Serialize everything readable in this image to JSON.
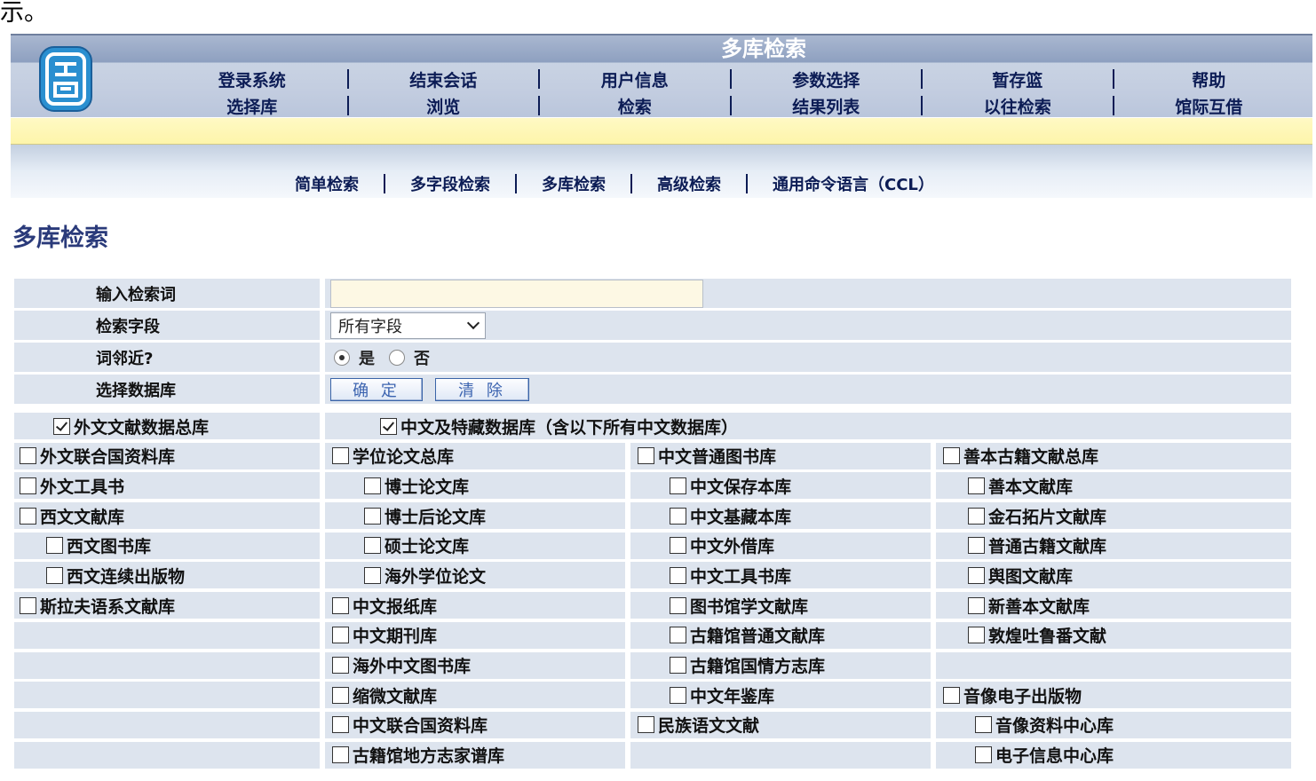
{
  "fragment_text": "示。",
  "header": {
    "title": "多库检索",
    "row1": [
      "登录系统",
      "结束会话",
      "用户信息",
      "参数选择",
      "暂存篮",
      "帮助"
    ],
    "row2": [
      "选择库",
      "浏览",
      "检索",
      "结果列表",
      "以往检索",
      "馆际互借"
    ]
  },
  "subnav": [
    "简单检索",
    "多字段检索",
    "多库检索",
    "高级检索",
    "通用命令语言（CCL）"
  ],
  "page_title": "多库检索",
  "form": {
    "keyword_label": "输入检索词",
    "keyword_value": "",
    "field_label": "检索字段",
    "field_selected": "所有字段",
    "adjacent_label": "词邻近?",
    "yes": "是",
    "no": "否",
    "yes_selected": true,
    "db_label": "选择数据库",
    "ok_button": "确 定",
    "clear_button": "清 除"
  },
  "databases": {
    "all_foreign": "外文文献数据总库",
    "all_chinese": "中文及特藏数据库（含以下所有中文数据库）",
    "col1": [
      "外文联合国资料库",
      "外文工具书",
      "西文文献库",
      "西文图书库",
      "西文连续出版物",
      "斯拉夫语系文献库"
    ],
    "col2": [
      "学位论文总库",
      "博士论文库",
      "博士后论文库",
      "硕士论文库",
      "海外学位论文",
      "中文报纸库",
      "中文期刊库",
      "海外中文图书库",
      "缩微文献库",
      "中文联合国资料库",
      "古籍馆地方志家谱库"
    ],
    "col3": [
      "中文普通图书库",
      "中文保存本库",
      "中文基藏本库",
      "中文外借库",
      "中文工具书库",
      "图书馆学文献库",
      "古籍馆普通文献库",
      "古籍馆国情方志库",
      "中文年鉴库",
      "民族语文文献"
    ],
    "col4": [
      "善本古籍文献总库",
      "善本文献库",
      "金石拓片文献库",
      "普通古籍文献库",
      "舆图文献库",
      "新善本文献库",
      "敦煌吐鲁番文献",
      "音像电子出版物",
      "音像资料中心库",
      "电子信息中心库"
    ]
  }
}
